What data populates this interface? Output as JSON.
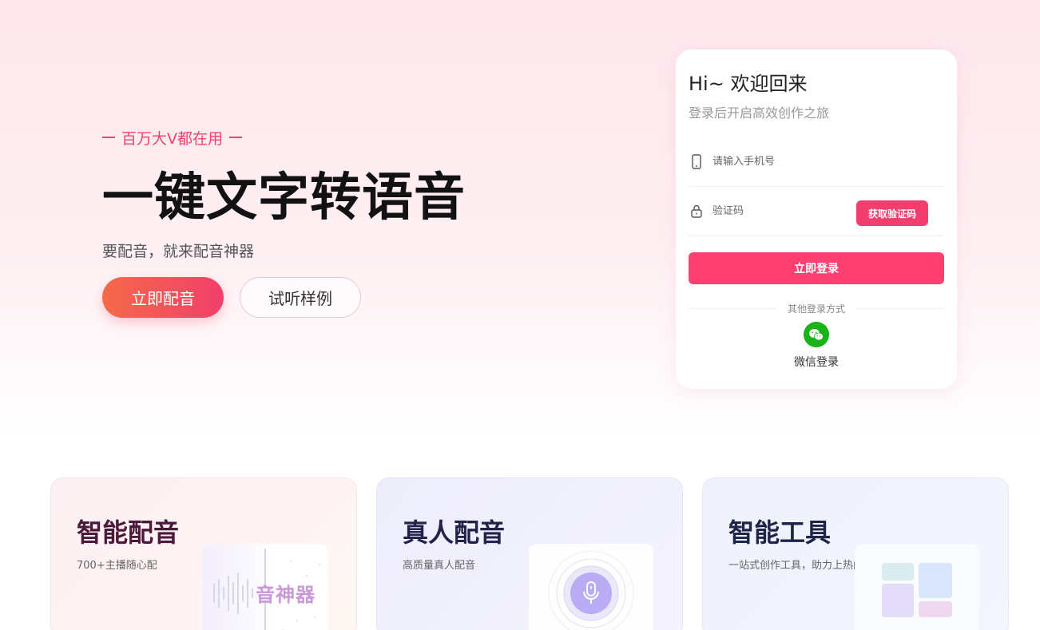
{
  "hero": {
    "tagline": "百万大V都在用",
    "title": "一键文字转语音",
    "subtitle": "要配音，就来配音神器",
    "primary_button": "立即配音",
    "secondary_button": "试听样例"
  },
  "login": {
    "title": "Hi~ 欢迎回来",
    "subtitle": "登录后开启高效创作之旅",
    "phone_placeholder": "请输入手机号",
    "code_placeholder": "验证码",
    "get_code_button": "获取验证码",
    "submit_button": "立即登录",
    "other_methods": "其他登录方式",
    "wechat_label": "微信登录"
  },
  "features": [
    {
      "title": "智能配音",
      "desc": "700+主播随心配",
      "thumb_text": "音神器"
    },
    {
      "title": "真人配音",
      "desc": "高质量真人配音"
    },
    {
      "title": "智能工具",
      "desc": "一站式创作工具，助力上热门"
    }
  ],
  "colors": {
    "accent": "#f23d6e",
    "primary_gradient_start": "#f56a49",
    "primary_gradient_end": "#f13f6b",
    "wechat": "#19b219"
  },
  "icons": {
    "phone": "phone-icon",
    "lock": "lock-icon",
    "wechat": "wechat-icon",
    "mic": "microphone-icon"
  }
}
